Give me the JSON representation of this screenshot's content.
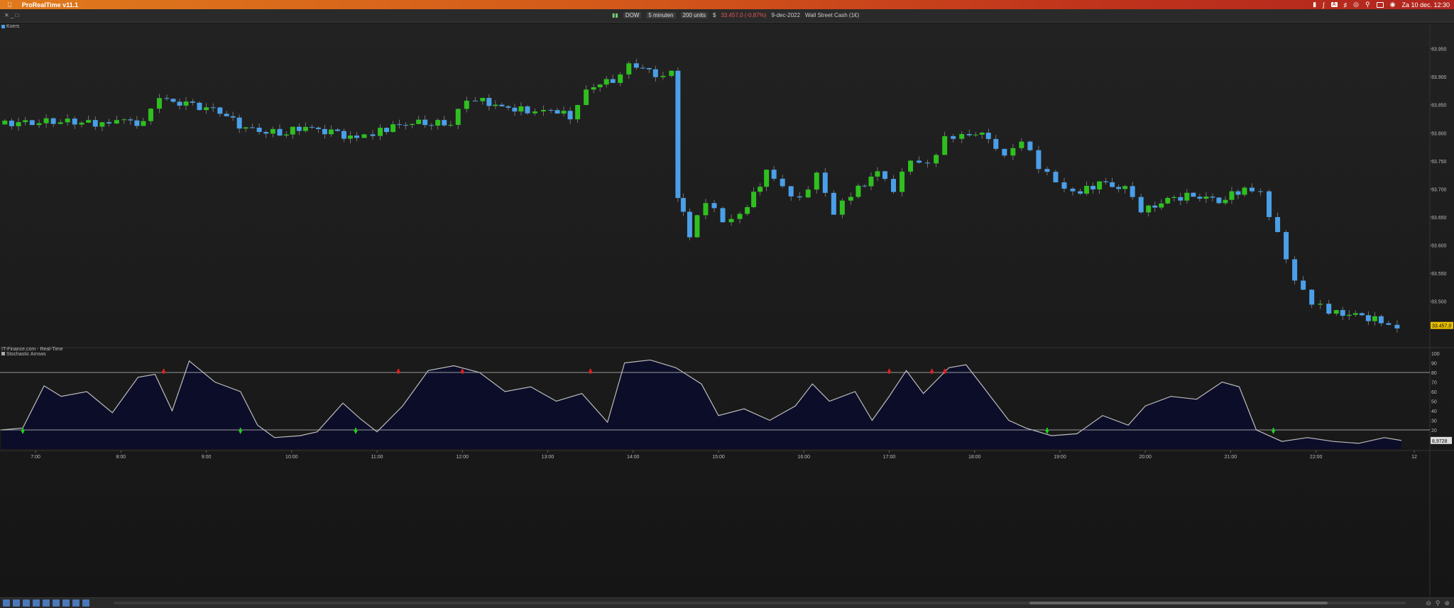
{
  "menubar": {
    "app_name": "ProRealTime v11.1",
    "datetime": "Za 10 dec. 12:30",
    "a_badge": "A"
  },
  "toolbar": {
    "instrument": "DOW",
    "timeframe": "5 minuten",
    "units": "200 units",
    "currency": "$",
    "last_price": "33.457,0 (-0,87%)",
    "date": "9-dec-2022",
    "market": "Wall Street Cash (1€)"
  },
  "panel": {
    "label": "Koers",
    "source": "IT-Finance.com - Real-Time",
    "indicator": "Stochastic Arrows"
  },
  "price_axis": {
    "ticks": [
      "33.950",
      "33.900",
      "33.850",
      "33.800",
      "33.750",
      "33.700",
      "33.650",
      "33.600",
      "33.550",
      "33.500"
    ],
    "current": "33.457,0"
  },
  "osc_axis": {
    "ticks": [
      "100",
      "90",
      "80",
      "70",
      "60",
      "50",
      "40",
      "30",
      "20",
      "10"
    ],
    "current": "8,9728"
  },
  "time_axis": {
    "ticks": [
      "7:00",
      "8:00",
      "9:00",
      "10:00",
      "11:00",
      "12:00",
      "13:00",
      "14:00",
      "15:00",
      "16:00",
      "17:00",
      "18:00",
      "19:00",
      "20:00",
      "21:00",
      "22:00",
      "12"
    ]
  },
  "colors": {
    "up": "#2fbf1f",
    "down": "#4a9fe8",
    "level": "#9a9a9a",
    "line": "#bdbdbd",
    "sell_arrow": "#e02020",
    "buy_arrow": "#20d020",
    "price_badge": "#e8c000"
  },
  "chart_data": [
    {
      "type": "candlestick",
      "title": "Koers",
      "ylim": [
        33420,
        33995
      ],
      "x_range_hours": [
        6.6,
        23.3
      ],
      "close_series": [
        {
          "t": 6.6,
          "v": 33815
        },
        {
          "t": 7.0,
          "v": 33820
        },
        {
          "t": 7.5,
          "v": 33820
        },
        {
          "t": 7.9,
          "v": 33815
        },
        {
          "t": 8.0,
          "v": 33825
        },
        {
          "t": 8.3,
          "v": 33815
        },
        {
          "t": 8.5,
          "v": 33860
        },
        {
          "t": 8.8,
          "v": 33850
        },
        {
          "t": 9.2,
          "v": 33840
        },
        {
          "t": 9.5,
          "v": 33805
        },
        {
          "t": 9.9,
          "v": 33800
        },
        {
          "t": 10.2,
          "v": 33810
        },
        {
          "t": 10.5,
          "v": 33800
        },
        {
          "t": 10.8,
          "v": 33790
        },
        {
          "t": 11.0,
          "v": 33800
        },
        {
          "t": 11.3,
          "v": 33815
        },
        {
          "t": 11.6,
          "v": 33820
        },
        {
          "t": 11.9,
          "v": 33815
        },
        {
          "t": 12.0,
          "v": 33845
        },
        {
          "t": 12.2,
          "v": 33860
        },
        {
          "t": 12.5,
          "v": 33845
        },
        {
          "t": 12.8,
          "v": 33840
        },
        {
          "t": 13.0,
          "v": 33845
        },
        {
          "t": 13.3,
          "v": 33830
        },
        {
          "t": 13.5,
          "v": 33880
        },
        {
          "t": 13.8,
          "v": 33895
        },
        {
          "t": 14.0,
          "v": 33925
        },
        {
          "t": 14.3,
          "v": 33905
        },
        {
          "t": 14.5,
          "v": 33910
        },
        {
          "t": 14.55,
          "v": 33690
        },
        {
          "t": 14.7,
          "v": 33620
        },
        {
          "t": 14.9,
          "v": 33680
        },
        {
          "t": 15.1,
          "v": 33640
        },
        {
          "t": 15.3,
          "v": 33650
        },
        {
          "t": 15.6,
          "v": 33730
        },
        {
          "t": 15.8,
          "v": 33700
        },
        {
          "t": 16.0,
          "v": 33680
        },
        {
          "t": 16.2,
          "v": 33730
        },
        {
          "t": 16.4,
          "v": 33660
        },
        {
          "t": 16.6,
          "v": 33690
        },
        {
          "t": 16.9,
          "v": 33730
        },
        {
          "t": 17.1,
          "v": 33700
        },
        {
          "t": 17.3,
          "v": 33750
        },
        {
          "t": 17.5,
          "v": 33740
        },
        {
          "t": 17.7,
          "v": 33790
        },
        {
          "t": 17.9,
          "v": 33800
        },
        {
          "t": 18.2,
          "v": 33795
        },
        {
          "t": 18.4,
          "v": 33760
        },
        {
          "t": 18.6,
          "v": 33790
        },
        {
          "t": 18.8,
          "v": 33740
        },
        {
          "t": 19.0,
          "v": 33710
        },
        {
          "t": 19.2,
          "v": 33690
        },
        {
          "t": 19.5,
          "v": 33710
        },
        {
          "t": 19.8,
          "v": 33700
        },
        {
          "t": 20.0,
          "v": 33660
        },
        {
          "t": 20.3,
          "v": 33680
        },
        {
          "t": 20.6,
          "v": 33690
        },
        {
          "t": 20.9,
          "v": 33680
        },
        {
          "t": 21.2,
          "v": 33700
        },
        {
          "t": 21.4,
          "v": 33690
        },
        {
          "t": 21.6,
          "v": 33620
        },
        {
          "t": 21.8,
          "v": 33540
        },
        {
          "t": 22.0,
          "v": 33500
        },
        {
          "t": 22.2,
          "v": 33480
        },
        {
          "t": 22.5,
          "v": 33475
        },
        {
          "t": 22.8,
          "v": 33465
        },
        {
          "t": 23.0,
          "v": 33457
        }
      ]
    },
    {
      "type": "line",
      "title": "Stochastic Arrows",
      "ylim": [
        0,
        100
      ],
      "levels": [
        80,
        20
      ],
      "points": [
        {
          "t": 6.6,
          "v": 20
        },
        {
          "t": 6.85,
          "v": 22
        },
        {
          "t": 7.1,
          "v": 66
        },
        {
          "t": 7.3,
          "v": 55
        },
        {
          "t": 7.6,
          "v": 60
        },
        {
          "t": 7.9,
          "v": 38
        },
        {
          "t": 8.2,
          "v": 75
        },
        {
          "t": 8.4,
          "v": 78
        },
        {
          "t": 8.6,
          "v": 40
        },
        {
          "t": 8.8,
          "v": 92
        },
        {
          "t": 9.1,
          "v": 70
        },
        {
          "t": 9.4,
          "v": 60
        },
        {
          "t": 9.6,
          "v": 25
        },
        {
          "t": 9.8,
          "v": 12
        },
        {
          "t": 10.1,
          "v": 14
        },
        {
          "t": 10.3,
          "v": 18
        },
        {
          "t": 10.6,
          "v": 48
        },
        {
          "t": 10.8,
          "v": 32
        },
        {
          "t": 11.0,
          "v": 18
        },
        {
          "t": 11.3,
          "v": 45
        },
        {
          "t": 11.6,
          "v": 82
        },
        {
          "t": 11.9,
          "v": 87
        },
        {
          "t": 12.2,
          "v": 80
        },
        {
          "t": 12.5,
          "v": 60
        },
        {
          "t": 12.8,
          "v": 65
        },
        {
          "t": 13.1,
          "v": 50
        },
        {
          "t": 13.4,
          "v": 58
        },
        {
          "t": 13.7,
          "v": 28
        },
        {
          "t": 13.9,
          "v": 90
        },
        {
          "t": 14.2,
          "v": 93
        },
        {
          "t": 14.5,
          "v": 85
        },
        {
          "t": 14.8,
          "v": 68
        },
        {
          "t": 15.0,
          "v": 35
        },
        {
          "t": 15.3,
          "v": 42
        },
        {
          "t": 15.6,
          "v": 30
        },
        {
          "t": 15.9,
          "v": 45
        },
        {
          "t": 16.1,
          "v": 68
        },
        {
          "t": 16.3,
          "v": 50
        },
        {
          "t": 16.6,
          "v": 60
        },
        {
          "t": 16.8,
          "v": 30
        },
        {
          "t": 17.0,
          "v": 55
        },
        {
          "t": 17.2,
          "v": 82
        },
        {
          "t": 17.4,
          "v": 58
        },
        {
          "t": 17.7,
          "v": 85
        },
        {
          "t": 17.9,
          "v": 88
        },
        {
          "t": 18.1,
          "v": 65
        },
        {
          "t": 18.4,
          "v": 30
        },
        {
          "t": 18.6,
          "v": 22
        },
        {
          "t": 18.9,
          "v": 14
        },
        {
          "t": 19.2,
          "v": 16
        },
        {
          "t": 19.5,
          "v": 35
        },
        {
          "t": 19.8,
          "v": 25
        },
        {
          "t": 20.0,
          "v": 45
        },
        {
          "t": 20.3,
          "v": 55
        },
        {
          "t": 20.6,
          "v": 52
        },
        {
          "t": 20.9,
          "v": 70
        },
        {
          "t": 21.1,
          "v": 65
        },
        {
          "t": 21.3,
          "v": 20
        },
        {
          "t": 21.6,
          "v": 8
        },
        {
          "t": 21.9,
          "v": 12
        },
        {
          "t": 22.2,
          "v": 8
        },
        {
          "t": 22.5,
          "v": 6
        },
        {
          "t": 22.8,
          "v": 12
        },
        {
          "t": 23.0,
          "v": 9
        }
      ],
      "sell_signals_t": [
        8.5,
        11.25,
        12.0,
        13.5,
        17.0,
        17.5,
        17.65
      ],
      "buy_signals_t": [
        6.85,
        9.4,
        10.75,
        18.85,
        21.5
      ]
    }
  ]
}
